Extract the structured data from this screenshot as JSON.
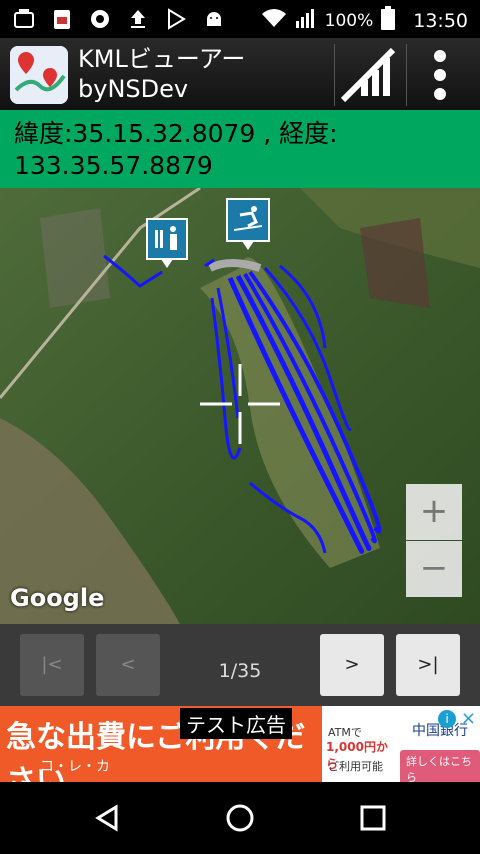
{
  "status_bar": {
    "battery": "100%",
    "time": "13:50",
    "icons": [
      "notification-icon",
      "pdf-icon",
      "record-icon",
      "upload-icon",
      "play-store-icon",
      "android-icon",
      "wifi-icon",
      "signal-icon",
      "battery-icon"
    ]
  },
  "app_bar": {
    "title_line1": "KMLビューアー",
    "title_line2": "byNSDev",
    "icons": [
      "app-logo-icon",
      "no-signal-icon",
      "overflow-menu-icon"
    ]
  },
  "coords": {
    "text": "緯度:35.15.32.8079 , 経度: 133.35.57.8879"
  },
  "map": {
    "google_label": "Google",
    "zoom_in": "+",
    "zoom_out": "−",
    "icons": [
      "restroom-icon",
      "ski-icon",
      "crosshair-icon"
    ]
  },
  "controls": {
    "first": "|<",
    "prev": "<",
    "counter": "1/35",
    "next": ">",
    "last": ">|"
  },
  "ad": {
    "label": "テスト広告",
    "headline": "急な出費にご利用ください",
    "brand": "コ・レ・カ",
    "atm": "ATMで",
    "amount": "1,000円から",
    "usage": "ご利用可能",
    "bank": "中国銀行",
    "cta": "詳しくはこちら"
  },
  "navbar": {
    "icons": [
      "back-icon",
      "home-icon",
      "recents-icon"
    ]
  }
}
